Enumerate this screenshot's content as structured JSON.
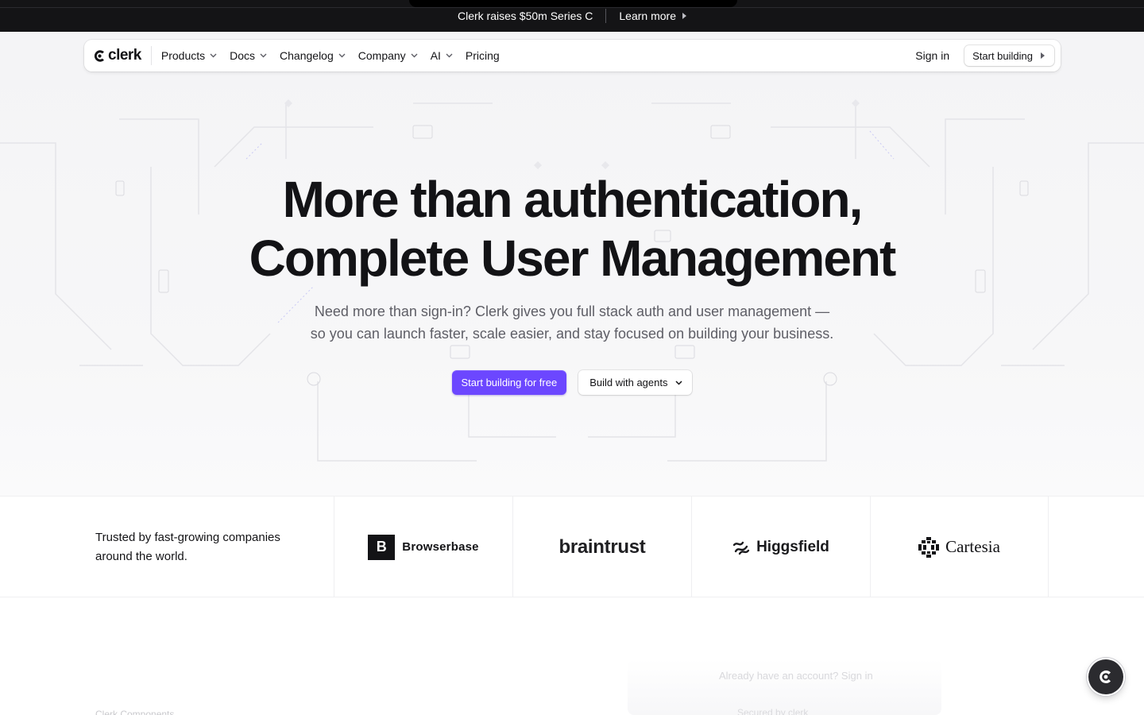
{
  "announcement": {
    "text": "Clerk raises $50m Series C",
    "link": "Learn more"
  },
  "nav": {
    "logo": "clerk",
    "items": [
      {
        "label": "Products",
        "dropdown": true
      },
      {
        "label": "Docs",
        "dropdown": true
      },
      {
        "label": "Changelog",
        "dropdown": true
      },
      {
        "label": "Company",
        "dropdown": true
      },
      {
        "label": "AI",
        "dropdown": true
      },
      {
        "label": "Pricing",
        "dropdown": false
      }
    ],
    "sign_in": "Sign in",
    "start_building": "Start building"
  },
  "hero": {
    "headline_line1": "More than authentication,",
    "headline_line2": "Complete User Management",
    "subhead_line1": "Need more than sign-in? Clerk gives you full stack auth and user management —",
    "subhead_line2": "so you can launch faster, scale easier, and stay focused on building your business.",
    "primary_cta": "Start building for free",
    "secondary_cta": "Build with agents"
  },
  "trusted": {
    "text": "Trusted by fast-growing companies around the world.",
    "logos": [
      {
        "name": "Browserbase",
        "mark": "B"
      },
      {
        "name": "braintrust"
      },
      {
        "name": "Higgsfield"
      },
      {
        "name": "Cartesia"
      }
    ]
  },
  "faded": {
    "preview_line1": "Already have an account? Sign in",
    "preview_line2": "Secured by clerk",
    "left_text": "Clerk Components"
  },
  "colors": {
    "accent": "#6c47ff",
    "announcement_bg": "#141416",
    "text": "#131316",
    "muted": "#5e5e66"
  }
}
